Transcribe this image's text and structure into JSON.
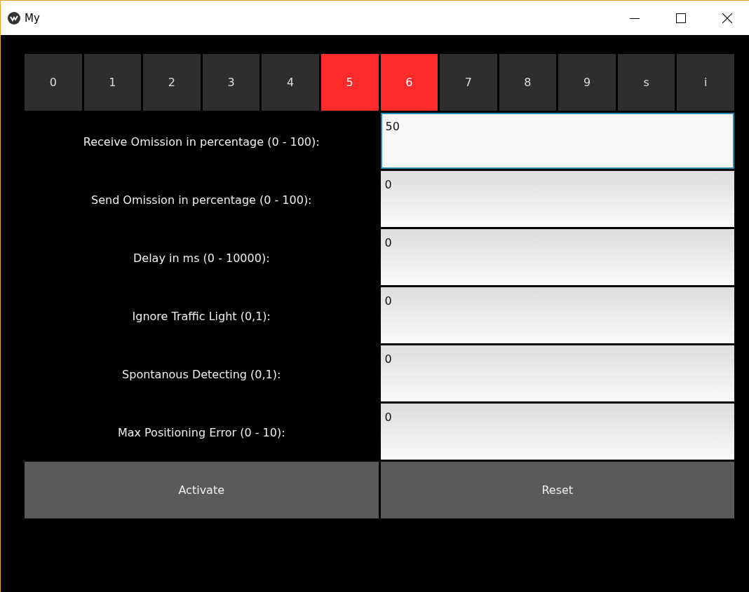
{
  "window": {
    "title": "My"
  },
  "tabs": [
    {
      "label": "0",
      "selected": false
    },
    {
      "label": "1",
      "selected": false
    },
    {
      "label": "2",
      "selected": false
    },
    {
      "label": "3",
      "selected": false
    },
    {
      "label": "4",
      "selected": false
    },
    {
      "label": "5",
      "selected": true
    },
    {
      "label": "6",
      "selected": true
    },
    {
      "label": "7",
      "selected": false
    },
    {
      "label": "8",
      "selected": false
    },
    {
      "label": "9",
      "selected": false
    },
    {
      "label": "s",
      "selected": false
    },
    {
      "label": "i",
      "selected": false
    }
  ],
  "fields": [
    {
      "label": "Receive Omission in percentage (0 - 100):",
      "value": "50",
      "focused": true
    },
    {
      "label": "Send Omission in percentage (0 - 100):",
      "value": "0",
      "focused": false
    },
    {
      "label": "Delay in ms (0 - 10000):",
      "value": "0",
      "focused": false
    },
    {
      "label": "Ignore Traffic Light (0,1):",
      "value": "0",
      "focused": false
    },
    {
      "label": "Spontanous Detecting (0,1):",
      "value": "0",
      "focused": false
    },
    {
      "label": "Max Positioning Error (0 - 10):",
      "value": "0",
      "focused": false
    }
  ],
  "buttons": [
    "Activate",
    "Reset"
  ]
}
